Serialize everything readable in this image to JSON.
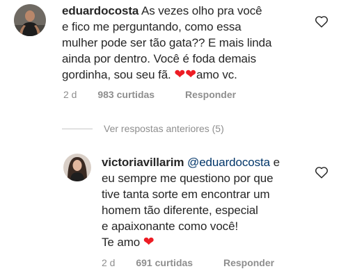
{
  "comments": [
    {
      "username": "eduardocosta",
      "lines": [
        "As vezes olho pra você",
        "e fico me perguntando, como essa",
        "mulher pode ser tão gata?? E mais linda",
        "ainda por dentro. Você é foda demais",
        "gordinha, sou seu fã."
      ],
      "tail": "amo vc.",
      "time": "2 d",
      "likes": "983 curtidas",
      "reply_label": "Responder"
    },
    {
      "username": "victoriavillarim",
      "mention": "@eduardocosta",
      "lines": [
        "e",
        "eu sempre me questiono por que",
        "tive tanta sorte em encontrar um",
        "homem tão diferente, especial",
        "e apaixonante como você!",
        "Te amo"
      ],
      "time": "2 d",
      "likes": "691 curtidas",
      "reply_label": "Responder"
    }
  ],
  "view_replies_label": "Ver respostas anteriores (5)",
  "icons": {
    "heart_emoji": "❤",
    "like_icon": "heart-outline-icon",
    "avatar_1": "avatar-photo-man",
    "avatar_2": "avatar-photo-woman"
  },
  "colors": {
    "text": "#262626",
    "meta": "#8e8e8e",
    "mention": "#003569",
    "heart": "#ed1c24"
  }
}
